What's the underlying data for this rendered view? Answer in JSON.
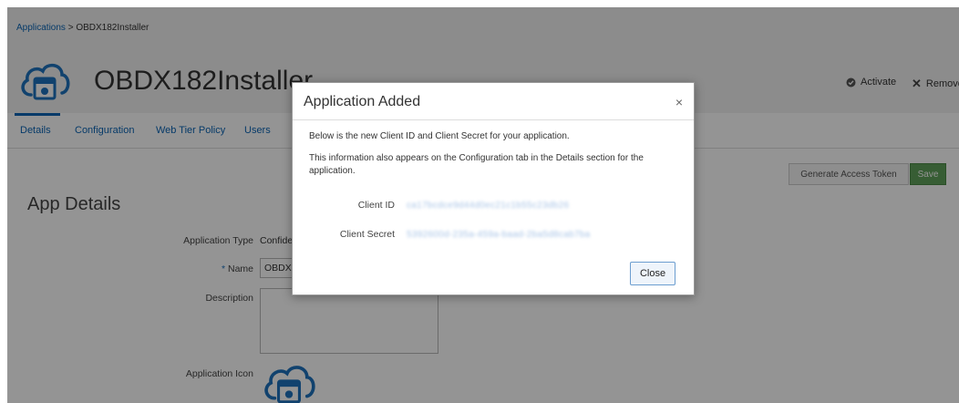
{
  "breadcrumb": {
    "root": "Applications",
    "separator": ">",
    "current": "OBDX182Installer"
  },
  "header": {
    "title": "OBDX182Installer",
    "activate_label": "Activate",
    "remove_label": "Remove"
  },
  "tabs": [
    {
      "label": "Details",
      "active": true
    },
    {
      "label": "Configuration",
      "active": false
    },
    {
      "label": "Web Tier Policy",
      "active": false
    },
    {
      "label": "Users",
      "active": false
    }
  ],
  "actions": {
    "generate_token_label": "Generate Access Token",
    "save_label": "Save"
  },
  "section": {
    "title": "App Details"
  },
  "form": {
    "app_type_label": "Application Type",
    "app_type_value": "Confide",
    "name_required_mark": "*",
    "name_label": "Name",
    "name_value": "OBDX",
    "description_label": "Description",
    "icon_label": "Application Icon"
  },
  "dialog": {
    "title": "Application Added",
    "close_glyph": "×",
    "line1": "Below is the new Client ID and Client Secret for your application.",
    "line2": "This information also appears on the Configuration tab in the Details section for the application.",
    "client_id_label": "Client ID",
    "client_id_value": "ca17bcdce9d44d0ec21c1b55c23db26",
    "client_secret_label": "Client Secret",
    "client_secret_value": "5392600d-235a-459a-baad-2ba5d8cab7ba",
    "close_button_label": "Close"
  },
  "colors": {
    "link": "#0b65b5",
    "save": "#5fa05a",
    "icon": "#1e73be"
  }
}
